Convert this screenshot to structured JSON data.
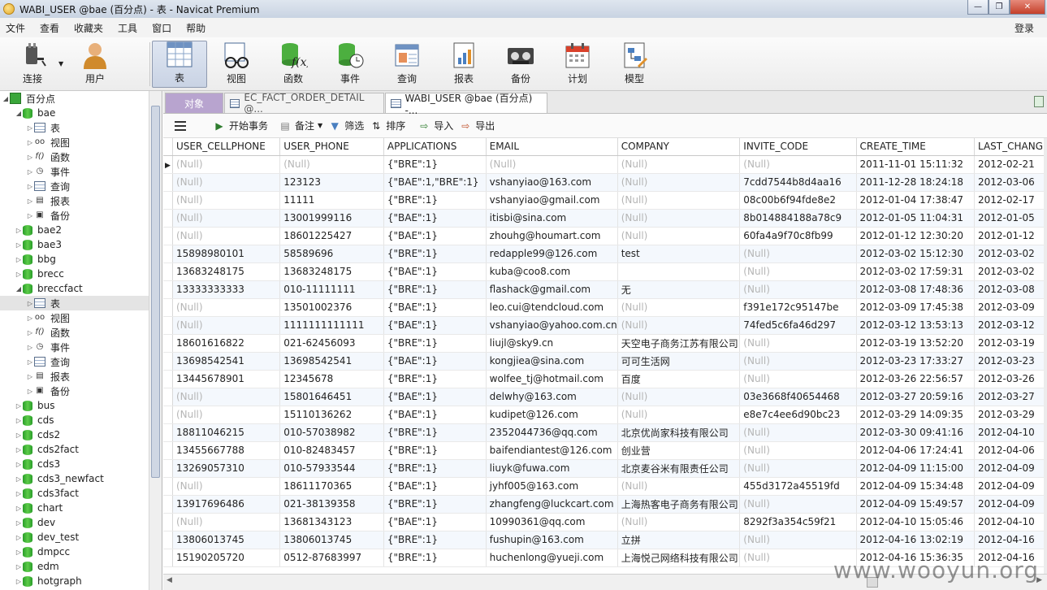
{
  "window": {
    "title": "WABI_USER @bae (百分点) - 表 - Navicat Premium"
  },
  "menu": {
    "items": [
      "文件",
      "查看",
      "收藏夹",
      "工具",
      "窗口",
      "帮助"
    ],
    "login": "登录"
  },
  "toolbar": {
    "items": [
      "连接",
      "用户",
      "表",
      "视图",
      "函数",
      "事件",
      "查询",
      "报表",
      "备份",
      "计划",
      "模型"
    ]
  },
  "sidebar": {
    "root": "百分点",
    "bae": "bae",
    "bae_children": [
      "表",
      "视图",
      "函数",
      "事件",
      "查询",
      "报表",
      "备份"
    ],
    "dbs_a": [
      "bae2",
      "bae3",
      "bbg",
      "brecc"
    ],
    "breccfact": "breccfact",
    "breccfact_children": [
      "表",
      "视图",
      "函数",
      "事件",
      "查询",
      "报表",
      "备份"
    ],
    "dbs_b": [
      "bus",
      "cds",
      "cds2",
      "cds2fact",
      "cds3",
      "cds3_newfact",
      "cds3fact",
      "chart",
      "dev",
      "dev_test",
      "dmpcc",
      "edm",
      "hotgraph"
    ]
  },
  "tabs": {
    "objects": "对象",
    "tab1": "EC_FACT_ORDER_DETAIL @...",
    "tab2": "WABI_USER @bae (百分点) -..."
  },
  "objbar": {
    "begin_tx": "开始事务",
    "notes": "备注",
    "filter": "筛选",
    "sort": "排序",
    "import": "导入",
    "export": "导出"
  },
  "grid": {
    "columns": [
      "USER_CELLPHONE",
      "USER_PHONE",
      "APPLICATIONS",
      "EMAIL",
      "COMPANY",
      "INVITE_CODE",
      "CREATE_TIME",
      "LAST_CHANG"
    ],
    "rows": [
      [
        "(Null)",
        "(Null)",
        "{\"BRE\":1}",
        "(Null)",
        "(Null)",
        "(Null)",
        "2011-11-01 15:11:32",
        "2012-02-21"
      ],
      [
        "(Null)",
        "123123",
        "{\"BAE\":1,\"BRE\":1}",
        "vshanyiao@163.com",
        "(Null)",
        "7cdd7544b8d4aa16",
        "2011-12-28 18:24:18",
        "2012-03-06"
      ],
      [
        "(Null)",
        "11111",
        "{\"BRE\":1}",
        "vshanyiao@gmail.com",
        "(Null)",
        "08c00b6f94fde8e2",
        "2012-01-04 17:38:47",
        "2012-02-17"
      ],
      [
        "(Null)",
        "13001999116",
        "{\"BAE\":1}",
        "itisbi@sina.com",
        "(Null)",
        "8b014884188a78c9",
        "2012-01-05 11:04:31",
        "2012-01-05"
      ],
      [
        "(Null)",
        "18601225427",
        "{\"BAE\":1}",
        "zhouhg@houmart.com",
        "(Null)",
        "60fa4a9f70c8fb99",
        "2012-01-12 12:30:20",
        "2012-01-12"
      ],
      [
        "15898980101",
        "58589696",
        "{\"BRE\":1}",
        "redapple99@126.com",
        "test",
        "(Null)",
        "2012-03-02 15:12:30",
        "2012-03-02"
      ],
      [
        "13683248175",
        "13683248175",
        "{\"BAE\":1}",
        "kuba@coo8.com",
        "",
        "(Null)",
        "2012-03-02 17:59:31",
        "2012-03-02"
      ],
      [
        "13333333333",
        "010-11111111",
        "{\"BRE\":1}",
        "flashack@gmail.com",
        "无",
        "(Null)",
        "2012-03-08 17:48:36",
        "2012-03-08"
      ],
      [
        "(Null)",
        "13501002376",
        "{\"BAE\":1}",
        "leo.cui@tendcloud.com",
        "(Null)",
        "f391e172c95147be",
        "2012-03-09 17:45:38",
        "2012-03-09"
      ],
      [
        "(Null)",
        "1111111111111",
        "{\"BAE\":1}",
        "vshanyiao@yahoo.com.cn",
        "(Null)",
        "74fed5c6fa46d297",
        "2012-03-12 13:53:13",
        "2012-03-12"
      ],
      [
        "18601616822",
        "021-62456093",
        "{\"BRE\":1}",
        "liujl@sky9.cn",
        "天空电子商务江苏有限公司",
        "(Null)",
        "2012-03-19 13:52:20",
        "2012-03-19"
      ],
      [
        "13698542541",
        "13698542541",
        "{\"BAE\":1}",
        "kongjiea@sina.com",
        "可可生活网",
        "(Null)",
        "2012-03-23 17:33:27",
        "2012-03-23"
      ],
      [
        "13445678901",
        "12345678",
        "{\"BRE\":1}",
        "wolfee_tj@hotmail.com",
        "百度",
        "(Null)",
        "2012-03-26 22:56:57",
        "2012-03-26"
      ],
      [
        "(Null)",
        "15801646451",
        "{\"BAE\":1}",
        "delwhy@163.com",
        "(Null)",
        "03e3668f40654468",
        "2012-03-27 20:59:16",
        "2012-03-27"
      ],
      [
        "(Null)",
        "15110136262",
        "{\"BAE\":1}",
        "kudipet@126.com",
        "(Null)",
        "e8e7c4ee6d90bc23",
        "2012-03-29 14:09:35",
        "2012-03-29"
      ],
      [
        "18811046215",
        "010-57038982",
        "{\"BRE\":1}",
        "2352044736@qq.com",
        "北京优尚家科技有限公司",
        "(Null)",
        "2012-03-30 09:41:16",
        "2012-04-10"
      ],
      [
        "13455667788",
        "010-82483457",
        "{\"BRE\":1}",
        "baifendiantest@126.com",
        "创业营",
        "(Null)",
        "2012-04-06 17:24:41",
        "2012-04-06"
      ],
      [
        "13269057310",
        "010-57933544",
        "{\"BRE\":1}",
        "liuyk@fuwa.com",
        "北京麦谷米有限责任公司",
        "(Null)",
        "2012-04-09 11:15:00",
        "2012-04-09"
      ],
      [
        "(Null)",
        "18611170365",
        "{\"BAE\":1}",
        "jyhf005@163.com",
        "(Null)",
        "455d3172a45519fd",
        "2012-04-09 15:34:48",
        "2012-04-09"
      ],
      [
        "13917696486",
        "021-38139358",
        "{\"BRE\":1}",
        "zhangfeng@luckcart.com",
        "上海热客电子商务有限公司",
        "(Null)",
        "2012-04-09 15:49:57",
        "2012-04-09"
      ],
      [
        "(Null)",
        "13681343123",
        "{\"BAE\":1}",
        "10990361@qq.com",
        "(Null)",
        "8292f3a354c59f21",
        "2012-04-10 15:05:46",
        "2012-04-10"
      ],
      [
        "13806013745",
        "13806013745",
        "{\"BRE\":1}",
        "fushupin@163.com",
        "立拼",
        "(Null)",
        "2012-04-16 13:02:19",
        "2012-04-16"
      ],
      [
        "15190205720",
        "0512-87683997",
        "{\"BRE\":1}",
        "huchenlong@yueji.com",
        "上海悦己网络科技有限公司",
        "(Null)",
        "2012-04-16 15:36:35",
        "2012-04-16"
      ]
    ]
  },
  "watermark": "www.wooyun.org"
}
